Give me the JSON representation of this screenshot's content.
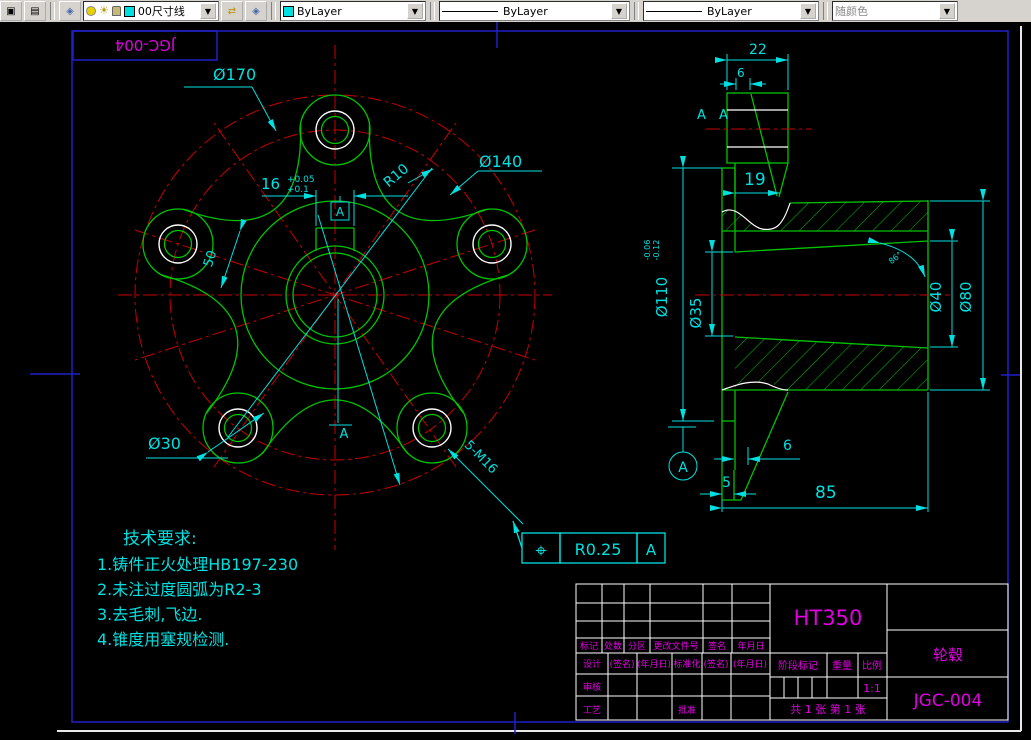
{
  "toolbar": {
    "layer_name": "00尺寸线",
    "color": "ByLayer",
    "linetype": "ByLayer",
    "lineweight": "ByLayer",
    "plot_style": "随颜色",
    "dropdown_arrow": "▼"
  },
  "sheet": {
    "corner_label": "JGC-004"
  },
  "front": {
    "d170": "Ø170",
    "d140": "Ø140",
    "r10": "R10",
    "key": "16",
    "key_tol_u": "+0.05",
    "key_tol_l": "+0.1",
    "datum_box": "A",
    "dim50": "50",
    "d30": "Ø30",
    "thread": "5-M16",
    "axis_datum": "A"
  },
  "section": {
    "w22": "22",
    "w6": "6",
    "a1": "A",
    "a2": "A",
    "w19": "19",
    "d110": "Ø110",
    "tol_u": "-0.06",
    "tol_l": "-0.12",
    "d35": "Ø35",
    "d40": "Ø40",
    "d80": "Ø80",
    "angle": "86°",
    "b6": "6",
    "b5": "5",
    "len85": "85",
    "datum": "A"
  },
  "fcf": {
    "sym": "⌖",
    "val": "R0.25",
    "ref": "A"
  },
  "tech": {
    "title": "技术要求:",
    "l1": "1.铸件正火处理HB197-230",
    "l2": "2.未注过度圆弧为R2-3",
    "l3": "3.去毛刺,飞边.",
    "l4": "4.锥度用塞规检测."
  },
  "tb": {
    "material": "HT350",
    "name": "轮毂",
    "no": "JGC-004",
    "scale_val": "1:1",
    "c1": "标记",
    "c2": "处数",
    "c3": "分区",
    "c4": "更改文件号",
    "c5": "签名",
    "c6": "年月日",
    "d1": "设计",
    "d2": "(签名)",
    "d3": "(年月日)",
    "d4": "标准化",
    "d5": "(签名)",
    "d6": "(年月日)",
    "shenhe": "审核",
    "gongyi": "工艺",
    "pizhun": "批准",
    "stage": "阶段标记",
    "weight": "重量",
    "scale": "比例",
    "sheets": "共 1 张 第 1 张"
  }
}
